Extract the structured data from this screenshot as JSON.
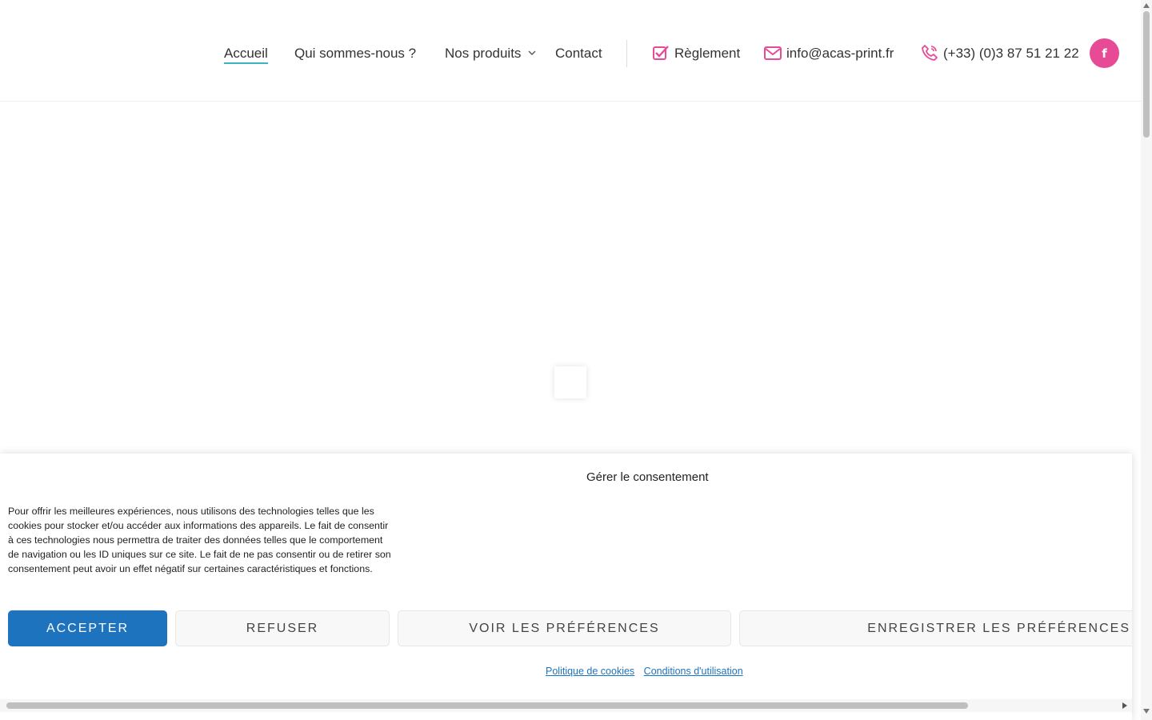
{
  "header": {
    "nav": [
      {
        "label": "Accueil",
        "active": true
      },
      {
        "label": "Qui sommes-nous ?"
      },
      {
        "label": "Nos produits",
        "has_dropdown": true
      },
      {
        "label": "Contact"
      }
    ],
    "info": {
      "reglement": {
        "label": "Règlement",
        "icon": "checkbox-icon"
      },
      "email": {
        "label": "info@acas-print.fr",
        "icon": "envelope-icon"
      },
      "phone": {
        "label": "(+33) (0)3 87 51 21 22",
        "icon": "phone-icon"
      }
    },
    "social": {
      "facebook_glyph": "f",
      "icon": "facebook-icon"
    }
  },
  "colors": {
    "accent_pink": "#e74b96",
    "nav_underline": "#3bb3c3",
    "primary_button": "#1e73be",
    "link": "#1e73be"
  },
  "cookie_banner": {
    "title": "Gérer le consentement",
    "text": "Pour offrir les meilleures expériences, nous utilisons des technologies telles que les cookies pour stocker et/ou accéder aux informations des appareils. Le fait de consentir à ces technologies nous permettra de traiter des données telles que le comportement de navigation ou les ID uniques sur ce site. Le fait de ne pas consentir ou de retirer son consentement peut avoir un effet négatif sur certaines caractéristiques et fonctions.",
    "buttons": {
      "accept": "ACCEPTER",
      "refuse": "REFUSER",
      "view_prefs": "VOIR LES PRÉFÉRENCES",
      "save_prefs": "ENREGISTRER LES PRÉFÉRENCES"
    },
    "links": {
      "cookie_policy": "Politique de cookies",
      "terms": "Conditions d'utilisation"
    }
  }
}
